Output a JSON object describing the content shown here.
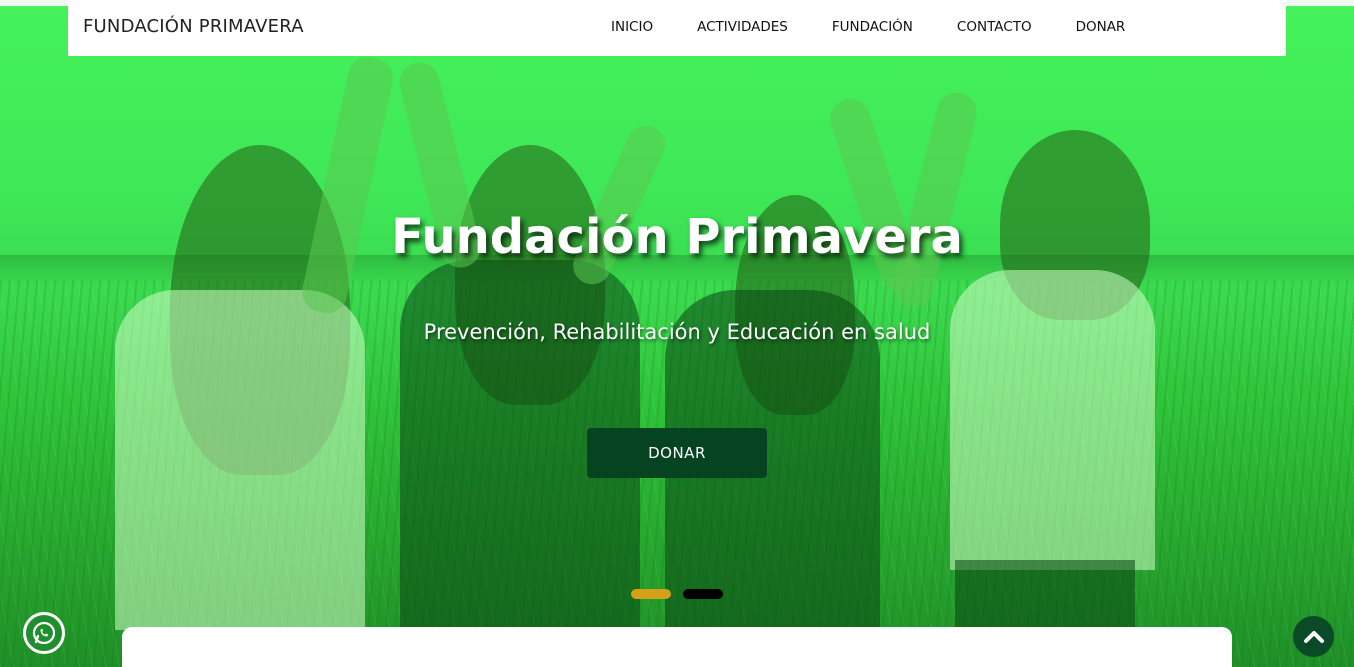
{
  "brand": {
    "name": "FUNDACIÓN PRIMAVERA"
  },
  "nav": {
    "items": [
      {
        "label": "INICIO"
      },
      {
        "label": "ACTIVIDADES"
      },
      {
        "label": "FUNDACIÓN"
      },
      {
        "label": "CONTACTO"
      },
      {
        "label": "DONAR"
      }
    ]
  },
  "hero": {
    "title": "Fundación Primavera",
    "subtitle": "Prevención, Rehabilitación y Educación en salud",
    "cta_label": "DONAR",
    "slides": [
      {
        "active": true,
        "color": "#d4a017"
      },
      {
        "active": false,
        "color": "#000000"
      }
    ]
  },
  "floating": {
    "whatsapp_icon": "whatsapp-icon",
    "scroll_top_icon": "chevron-up-icon"
  },
  "colors": {
    "accent": "#064320",
    "overlay_green": "#3ee757"
  }
}
